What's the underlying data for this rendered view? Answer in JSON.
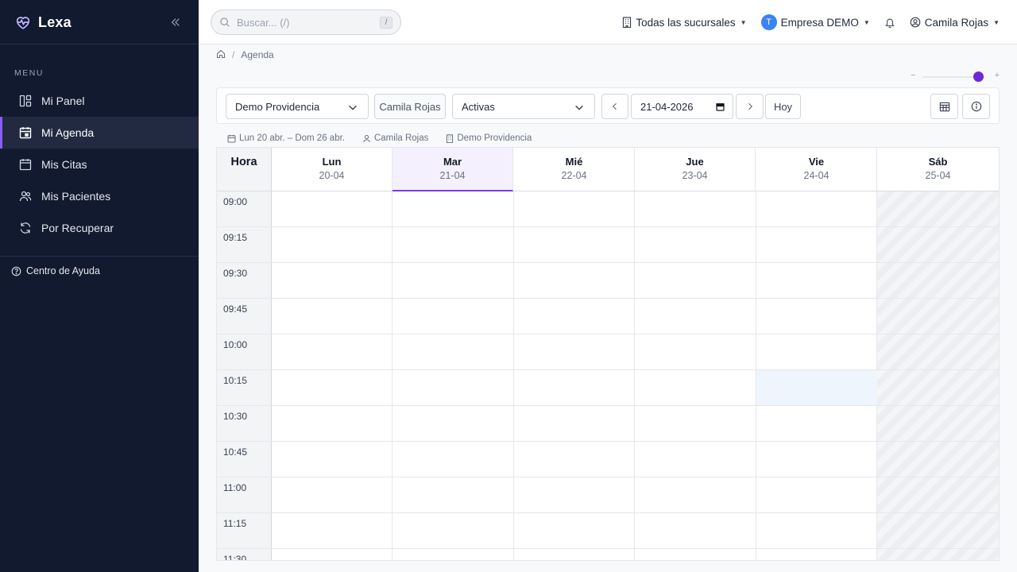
{
  "app": {
    "name": "Lexa"
  },
  "sidebar": {
    "menu_label": "MENU",
    "items": [
      {
        "label": "Mi Panel",
        "icon": "dashboard-icon"
      },
      {
        "label": "Mi Agenda",
        "icon": "calendar-icon",
        "active": true
      },
      {
        "label": "Mis Citas",
        "icon": "calendar-blank-icon"
      },
      {
        "label": "Mis Pacientes",
        "icon": "users-icon"
      },
      {
        "label": "Por Recuperar",
        "icon": "refresh-icon"
      }
    ],
    "help_label": "Centro de Ayuda"
  },
  "topbar": {
    "search_placeholder": "Buscar... (/)",
    "search_shortcut": "/",
    "branch_selector": "Todas las sucursales",
    "company_avatar": "T",
    "company": "Empresa DEMO",
    "user": "Camila Rojas"
  },
  "breadcrumb": {
    "current": "Agenda"
  },
  "zoom": {
    "level": 0.88
  },
  "toolbar": {
    "branch": "Demo Providencia",
    "professional": "Camila Rojas",
    "status_filter": "Activas",
    "date": "21-04-2026",
    "today_label": "Hoy"
  },
  "meta": {
    "range": "Lun 20 abr. – Dom 26 abr.",
    "professional": "Camila Rojas",
    "branch": "Demo Providencia"
  },
  "calendar": {
    "hour_header": "Hora",
    "days": [
      {
        "name": "Lun",
        "date": "20-04"
      },
      {
        "name": "Mar",
        "date": "21-04"
      },
      {
        "name": "Mié",
        "date": "22-04"
      },
      {
        "name": "Jue",
        "date": "23-04"
      },
      {
        "name": "Vie",
        "date": "24-04"
      },
      {
        "name": "Sáb",
        "date": "25-04"
      }
    ],
    "today_index": 1,
    "non_working_day_index": 5,
    "highlighted_slot": {
      "day_index": 4,
      "time": "10:15"
    },
    "times": [
      "09:00",
      "09:15",
      "09:30",
      "09:45",
      "10:00",
      "10:15",
      "10:30",
      "10:45",
      "11:00",
      "11:15",
      "11:30"
    ]
  },
  "colors": {
    "sidebar_bg": "#111a2f",
    "accent": "#7c3aed",
    "today_bg": "#f5f0fe",
    "highlight_slot": "#eff5fd"
  }
}
